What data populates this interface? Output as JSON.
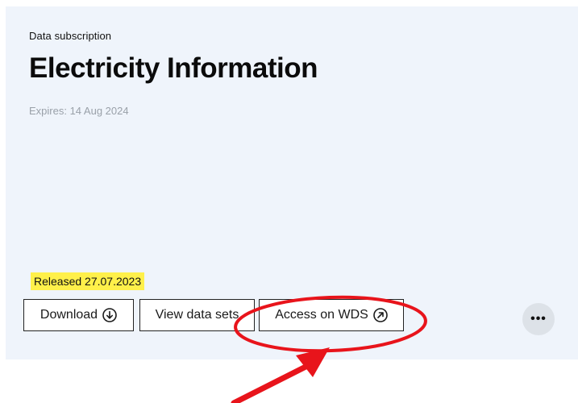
{
  "card": {
    "eyebrow": "Data subscription",
    "title": "Electricity Information",
    "expires": "Expires: 14 Aug 2024",
    "released": "Released 27.07.2023"
  },
  "actions": {
    "download_label": "Download",
    "download_icon": "download-circle-icon",
    "view_label": "View data sets",
    "access_label": "Access on WDS",
    "access_icon": "external-link-circle-icon",
    "more_label": "•••",
    "more_icon": "more-horizontal-icon"
  },
  "colors": {
    "card_background": "#eff4fb",
    "highlight": "#fff04a",
    "annotation": "#e8141b"
  }
}
